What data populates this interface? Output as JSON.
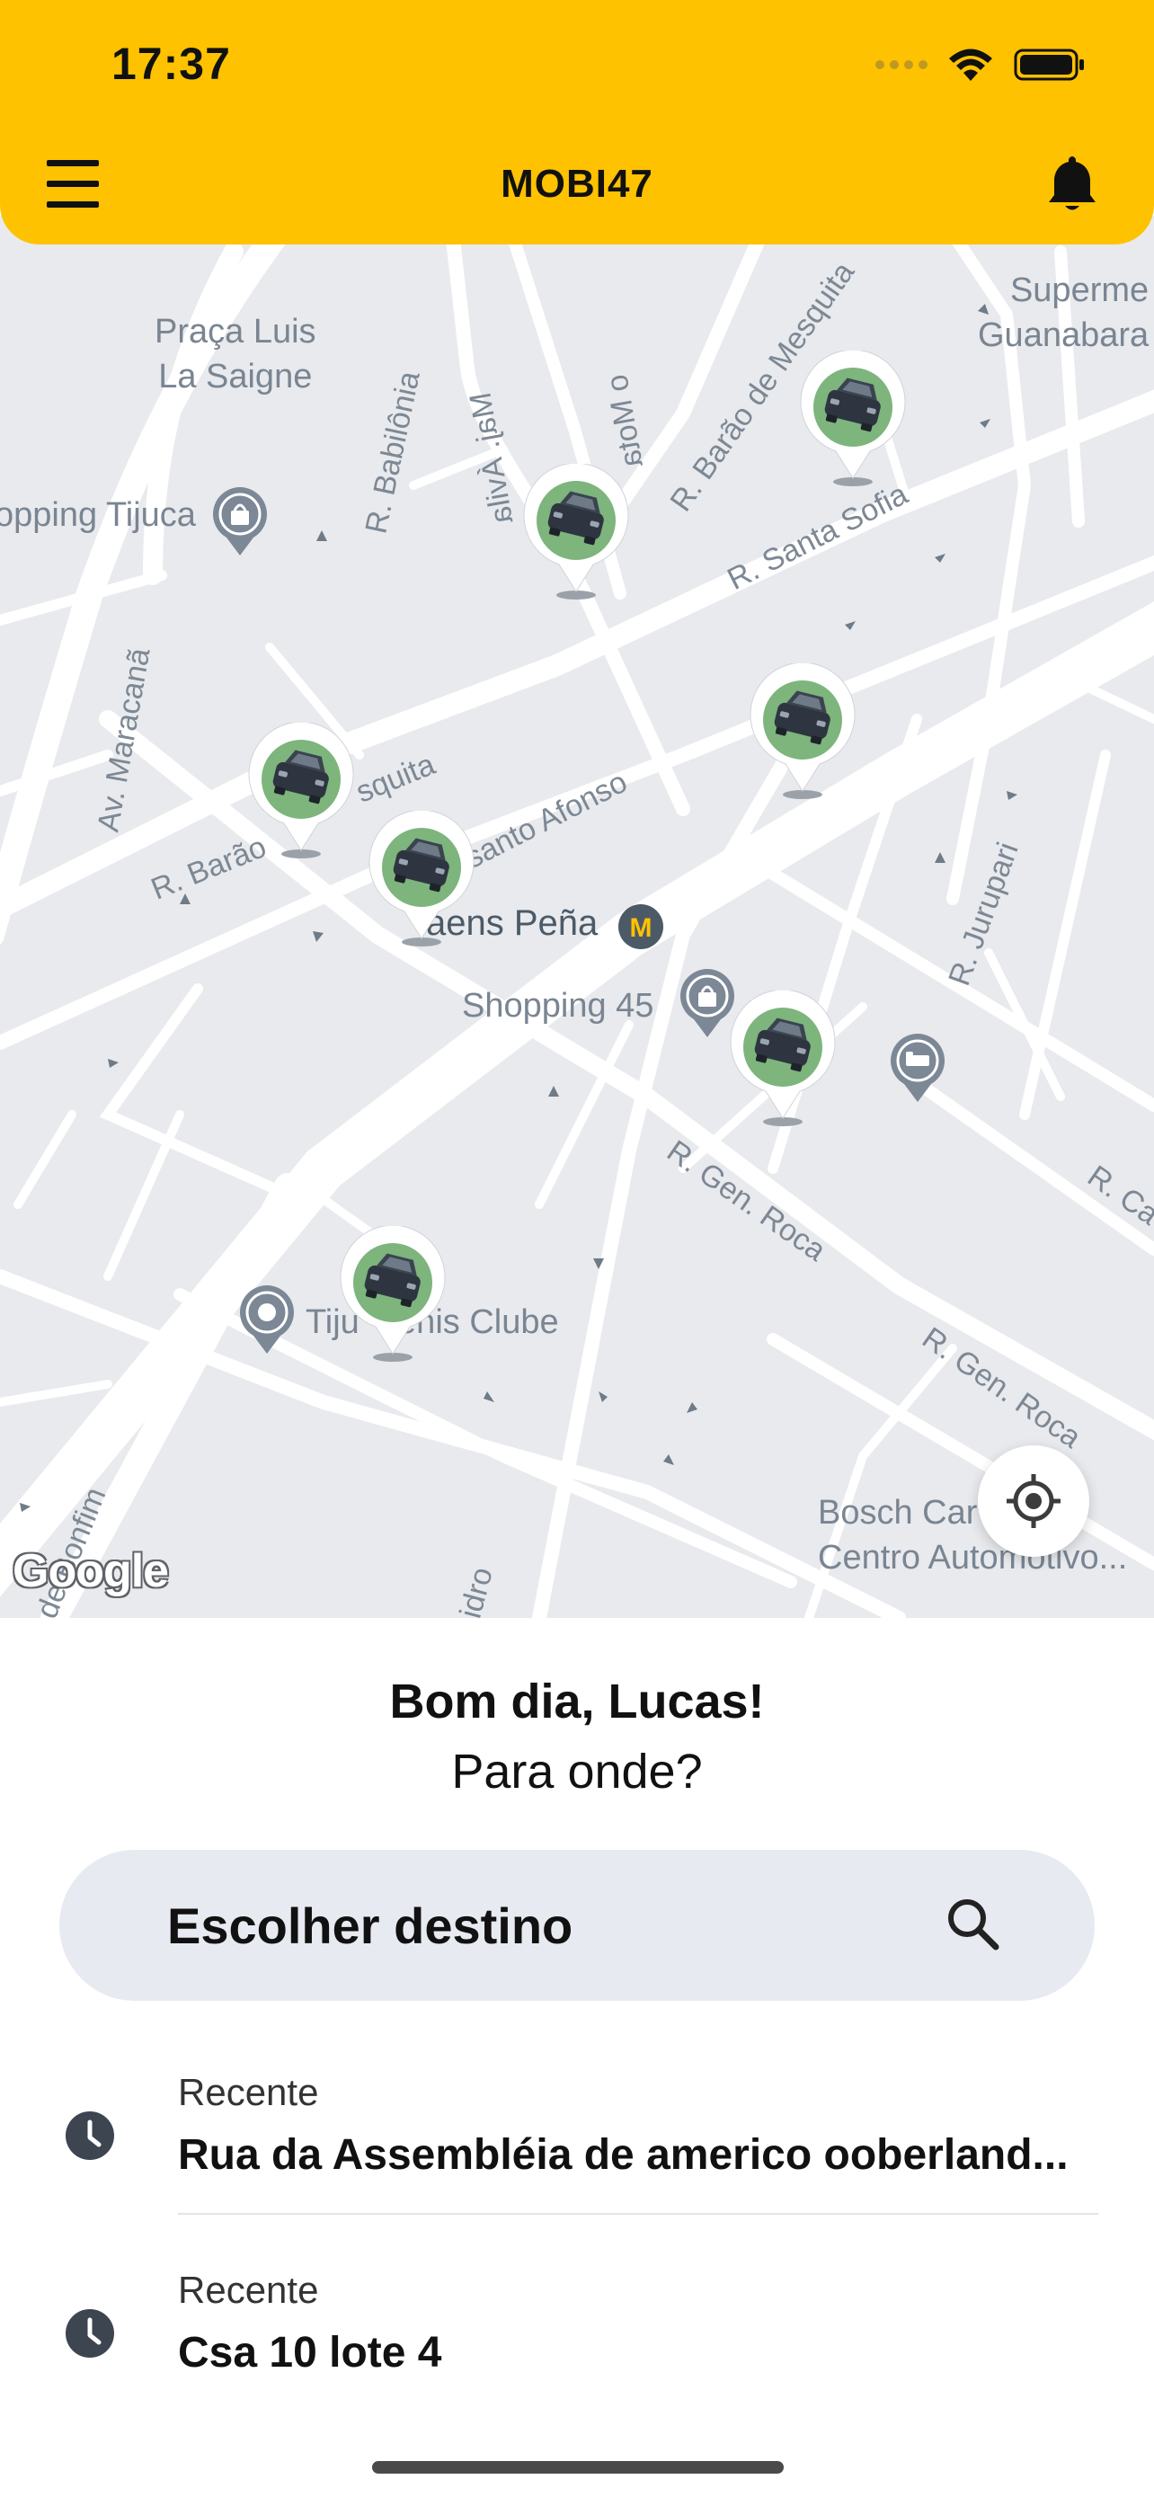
{
  "status_bar": {
    "time": "17:37"
  },
  "header": {
    "title": "MOBI47",
    "menu_icon": "hamburger-menu-icon",
    "notification_icon": "bell-icon",
    "brand_color": "#FEC200"
  },
  "map": {
    "places": {
      "praca": "Praça Luis\nLa Saigne",
      "shopping_tijuca": "opping Tijuca",
      "supermercado": "Superme\nGuanabara",
      "saens_pena": "aens Peña",
      "shopping_45": "Shopping 45",
      "tijuca_tenis": "Tiju    enis Clube",
      "bosch": "Bosch Car      ce -\nCentro Automotivo..."
    },
    "streets": {
      "babilonia": "R. Babilônia",
      "maj_avila": "Maj. Ávila",
      "mota": "o Mota",
      "barao_mesquita_top": "R. Barão de Mesquita",
      "santa_sofia": "R. Santa Sofia",
      "av_maracana": "Av. Maracanã",
      "barao_mesquita_left": "R. Barão",
      "barao_mesquita_left2": "squita",
      "santo_afonso": "santo Afonso",
      "jurupari": "R. Jurupari",
      "gen_roca_1": "R. Gen. Roca",
      "gen_roca_2": "R. Gen. Roca",
      "r_ca": "R. Ca",
      "bonfim": "e de Bonfim",
      "izidro": "Izidro"
    },
    "google_logo": "Google",
    "locate_icon": "crosshair-locate-icon",
    "car_icon": "car-icon"
  },
  "sheet": {
    "greeting": "Bom dia, Lucas!",
    "subtitle": "Para onde?",
    "search": {
      "placeholder": "Escolher destino",
      "icon": "search-icon"
    },
    "recents": [
      {
        "kicker": "Recente",
        "address": "Rua da Assembléia de americo ooberland...",
        "icon": "clock-icon"
      },
      {
        "kicker": "Recente",
        "address": "Csa 10 lote 4",
        "icon": "clock-icon"
      }
    ]
  }
}
